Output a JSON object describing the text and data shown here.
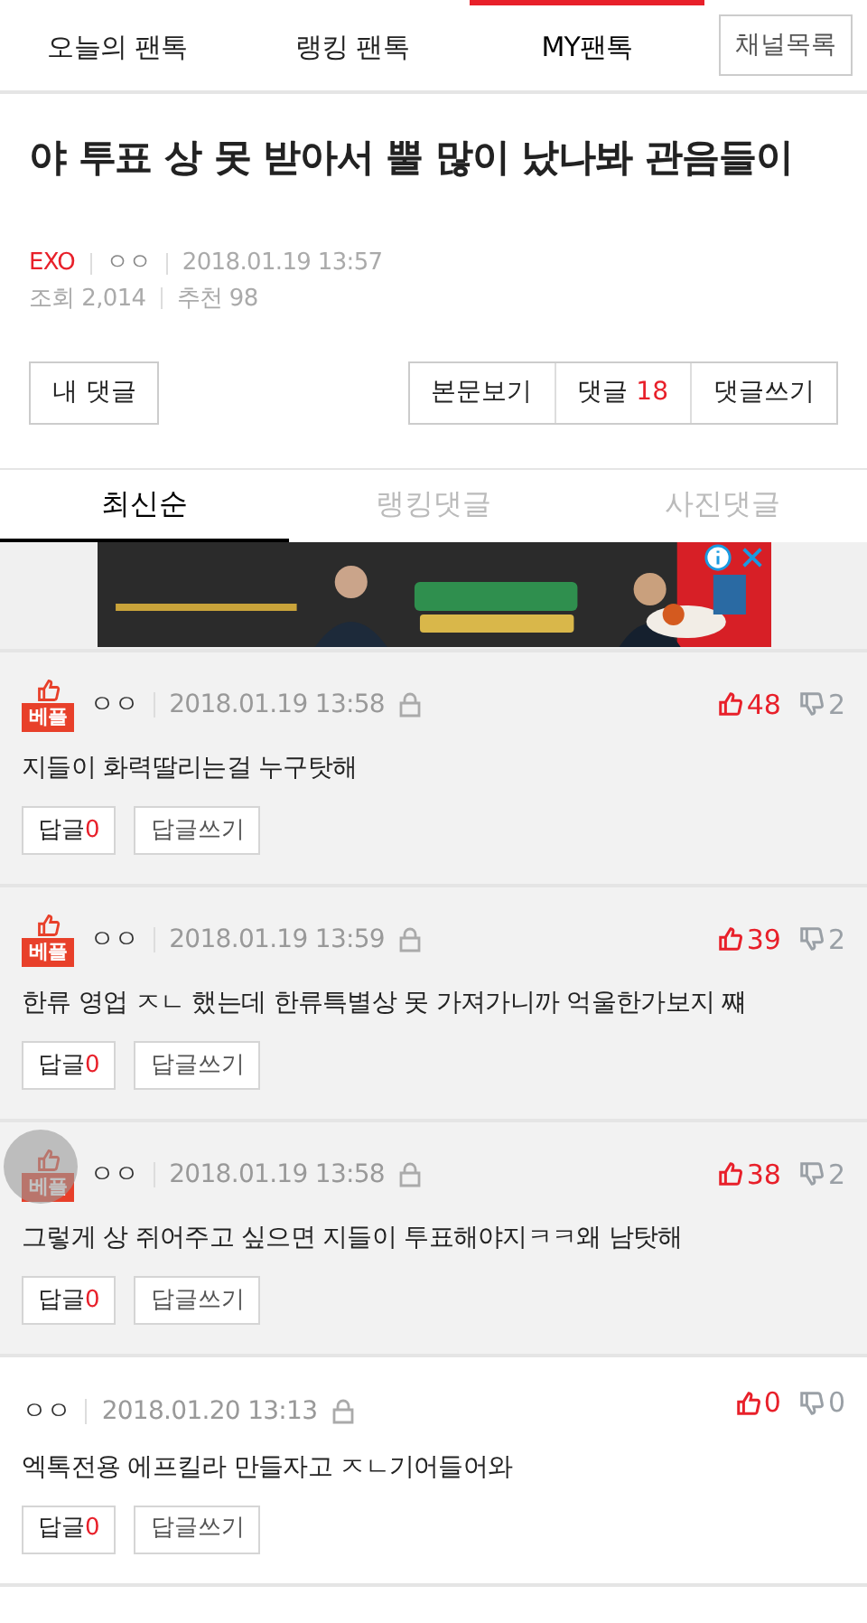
{
  "nav": {
    "tabs": [
      {
        "label": "오늘의 팬톡",
        "selected": false
      },
      {
        "label": "랭킹 팬톡",
        "selected": false
      },
      {
        "label": "MY팬톡",
        "selected": true
      }
    ],
    "channel_button": "채널목록"
  },
  "post": {
    "title": "야 투표 상 못 받아서 뿔 많이 났나봐 관음들이",
    "channel": "EXO",
    "author": "ㅇㅇ",
    "date": "2018.01.19 13:57",
    "views": "조회 2,014",
    "recommend": "추천 98"
  },
  "actions": {
    "my_comments": "내 댓글",
    "view_post": "본문보기",
    "comments_label": "댓글",
    "comments_count": "18",
    "write_comment": "댓글쓰기"
  },
  "sort_tabs": [
    {
      "label": "최신순",
      "selected": true
    },
    {
      "label": "랭킹댓글",
      "selected": false
    },
    {
      "label": "사진댓글",
      "selected": false
    }
  ],
  "comments": [
    {
      "best": true,
      "best_label": "베플",
      "author": "ㅇㅇ",
      "date": "2018.01.19 13:58",
      "likes": "48",
      "dislikes": "2",
      "text": "지들이 화력딸리는걸 누구탓해",
      "reply_label": "답글",
      "reply_count": "0",
      "write_reply": "답글쓰기"
    },
    {
      "best": true,
      "best_label": "베플",
      "author": "ㅇㅇ",
      "date": "2018.01.19 13:59",
      "likes": "39",
      "dislikes": "2",
      "text": "한류 영업 ㅈㄴ 했는데 한류특별상 못 가져가니까 억울한가보지 쨰",
      "reply_label": "답글",
      "reply_count": "0",
      "write_reply": "답글쓰기"
    },
    {
      "best": true,
      "best_label": "베플",
      "author": "ㅇㅇ",
      "date": "2018.01.19 13:58",
      "likes": "38",
      "dislikes": "2",
      "text": "그렇게 상 쥐어주고 싶으면 지들이 투표해야지ㅋㅋ왜 남탓해",
      "reply_label": "답글",
      "reply_count": "0",
      "write_reply": "답글쓰기"
    },
    {
      "best": false,
      "author": "ㅇㅇ",
      "date": "2018.01.20 13:13",
      "likes": "0",
      "dislikes": "0",
      "text": "엑톡전용 에프킬라 만들자고 ㅈㄴ기어들어와",
      "reply_label": "답글",
      "reply_count": "0",
      "write_reply": "답글쓰기"
    }
  ]
}
